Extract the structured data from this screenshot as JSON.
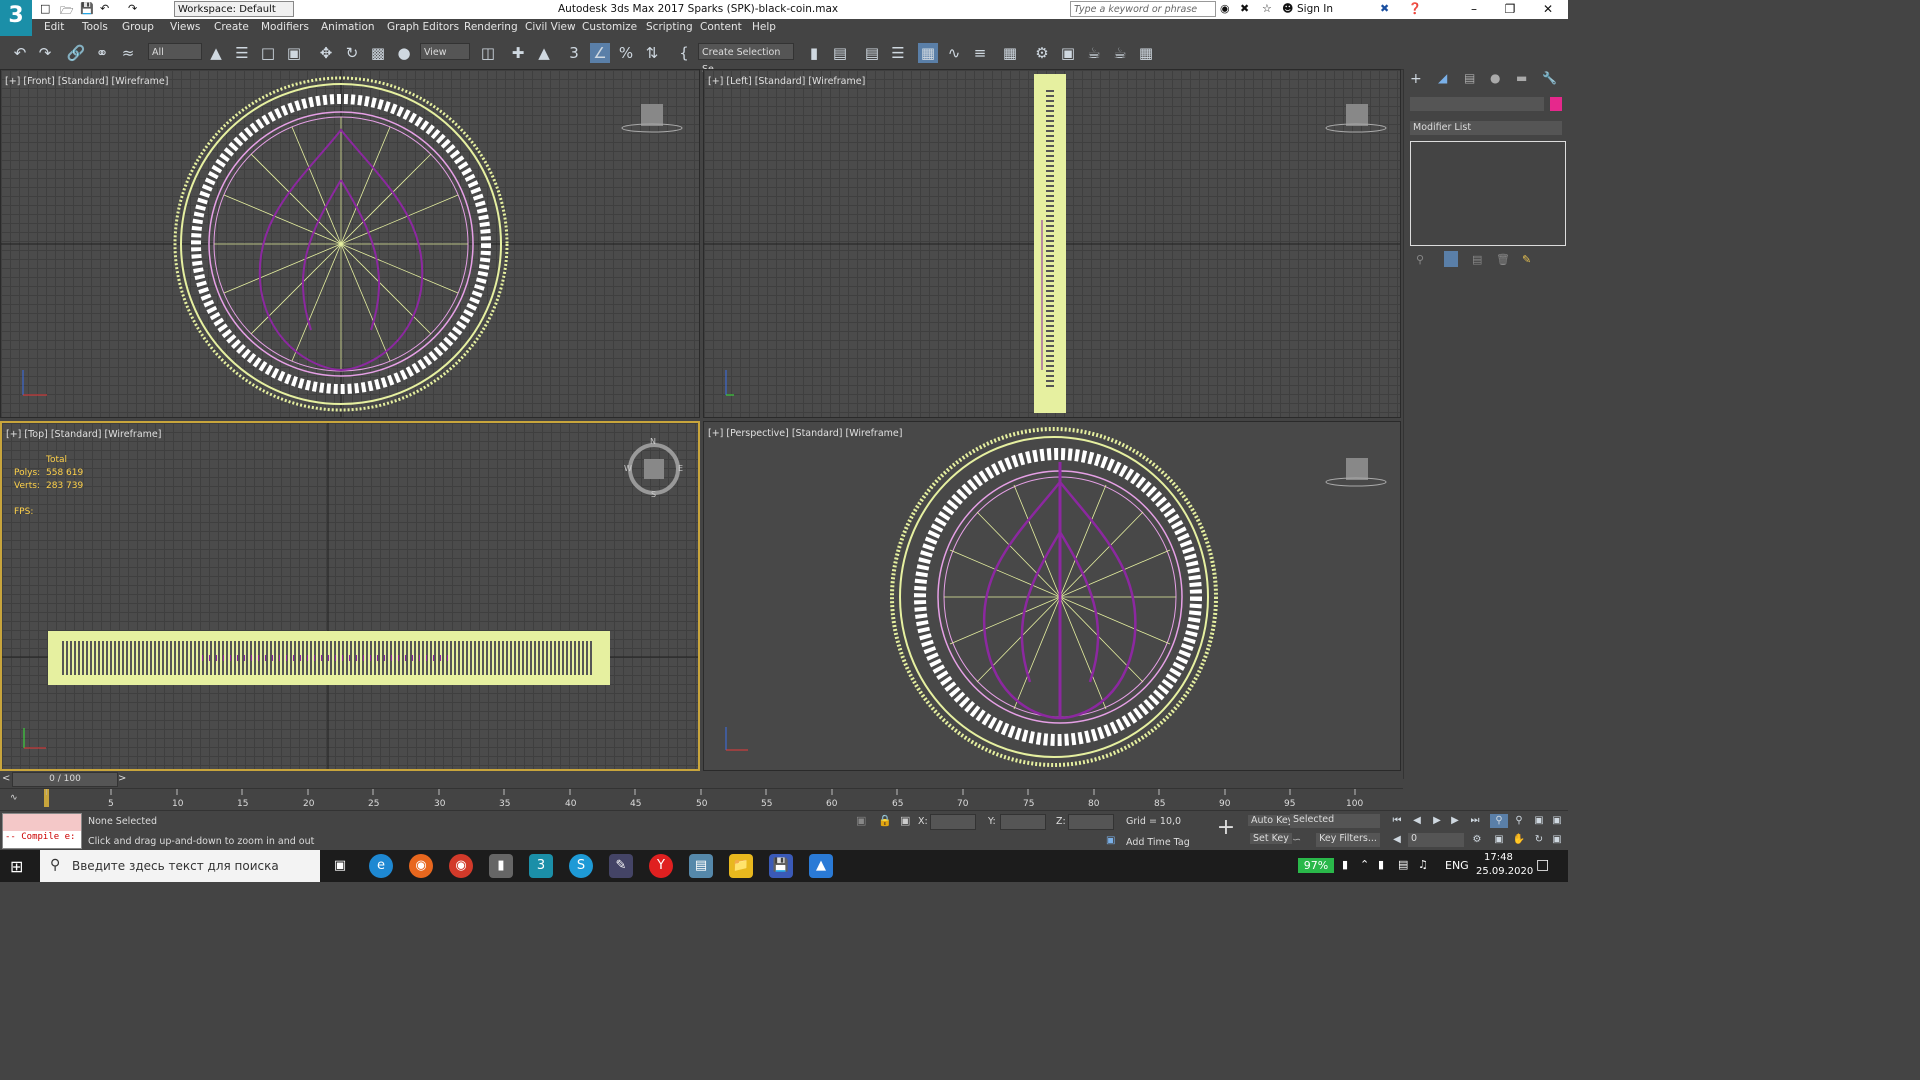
{
  "titlebar": {
    "workspace": "Workspace: Default",
    "title": "Autodesk 3ds Max 2017    Sparks (SPK)-black-coin.max",
    "search_placeholder": "Type a keyword or phrase",
    "signin": "Sign In"
  },
  "menus": [
    "Edit",
    "Tools",
    "Group",
    "Views",
    "Create",
    "Modifiers",
    "Animation",
    "Graph Editors",
    "Rendering",
    "Civil View",
    "Customize",
    "Scripting",
    "Content",
    "Help"
  ],
  "toolbar": {
    "filter": "All",
    "refcoord": "View",
    "selset": "Create Selection Se"
  },
  "viewports": {
    "front": "[+] [Front] [Standard] [Wireframe]",
    "left": "[+] [Left] [Standard] [Wireframe]",
    "top": "[+] [Top] [Standard] [Wireframe]",
    "persp": "[+] [Perspective] [Standard] [Wireframe]"
  },
  "stats": {
    "total_label": "Total",
    "polys_label": "Polys:",
    "polys": "558 619",
    "verts_label": "Verts:",
    "verts": "283 739",
    "fps_label": "FPS:"
  },
  "compass": {
    "n": "N",
    "s": "S",
    "e": "E",
    "w": "W"
  },
  "command_panel": {
    "modifier_list": "Modifier List",
    "color": "#e6288c"
  },
  "timeline": {
    "position": "0 / 100",
    "ticks": [
      "5",
      "10",
      "15",
      "20",
      "25",
      "30",
      "35",
      "40",
      "45",
      "50",
      "55",
      "60",
      "65",
      "70",
      "75",
      "80",
      "85",
      "90",
      "95",
      "100"
    ]
  },
  "status": {
    "compile": "-- Compile e:",
    "selection": "None Selected",
    "prompt": "Click and drag up-and-down to zoom in and out",
    "x_label": "X:",
    "y_label": "Y:",
    "z_label": "Z:",
    "grid": "Grid = 10,0",
    "add_time_tag": "Add Time Tag",
    "auto_key": "Auto Key",
    "set_key": "Set Key",
    "key_mode": "Selected",
    "key_filters": "Key Filters...",
    "frame": "0"
  },
  "taskbar": {
    "search": "Введите здесь текст для поиска",
    "battery": "97%",
    "lang": "ENG",
    "time": "17:48",
    "date": "25.09.2020"
  },
  "colors": {
    "wire_yellow": "#e6f0a0",
    "wire_pink": "#e6a0e6",
    "wire_purple": "#8c28a0",
    "active_border": "#c8a53c"
  }
}
